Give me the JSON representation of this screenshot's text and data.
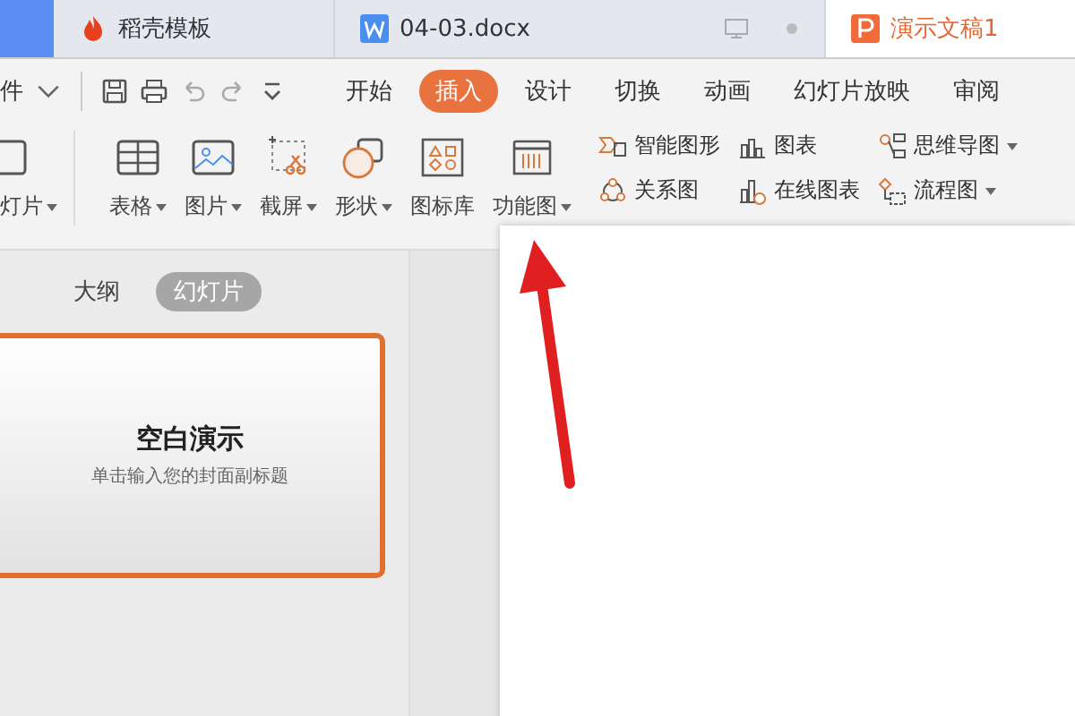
{
  "tabs": [
    {
      "label": "稻壳模板",
      "kind": "docer",
      "selected": false
    },
    {
      "label": "04-03.docx",
      "kind": "writer",
      "selected": false
    },
    {
      "label": "演示文稿1",
      "kind": "presentation",
      "selected": true
    }
  ],
  "menu": {
    "file_label": "件",
    "tabs": [
      {
        "label": "开始",
        "selected": false
      },
      {
        "label": "插入",
        "selected": true
      },
      {
        "label": "设计",
        "selected": false
      },
      {
        "label": "切换",
        "selected": false
      },
      {
        "label": "动画",
        "selected": false
      },
      {
        "label": "幻灯片放映",
        "selected": false
      },
      {
        "label": "审阅",
        "selected": false
      }
    ]
  },
  "ribbon": {
    "large": [
      {
        "label": "灯片",
        "kind": "slide",
        "dropdown": true
      },
      {
        "label": "表格",
        "kind": "table",
        "dropdown": true
      },
      {
        "label": "图片",
        "kind": "image",
        "dropdown": true
      },
      {
        "label": "截屏",
        "kind": "screenshot",
        "dropdown": true
      },
      {
        "label": "形状",
        "kind": "shape",
        "dropdown": true
      },
      {
        "label": "图标库",
        "kind": "iconlib",
        "dropdown": false
      },
      {
        "label": "功能图",
        "kind": "function",
        "dropdown": true
      }
    ],
    "small": [
      {
        "label": "智能图形",
        "kind": "smartart",
        "dropdown": false
      },
      {
        "label": "关系图",
        "kind": "relation",
        "dropdown": false
      },
      {
        "label": "图表",
        "kind": "chart",
        "dropdown": false
      },
      {
        "label": "在线图表",
        "kind": "onlinechart",
        "dropdown": false
      },
      {
        "label": "思维导图",
        "kind": "mindmap",
        "dropdown": true
      },
      {
        "label": "流程图",
        "kind": "flow",
        "dropdown": true
      }
    ]
  },
  "panel": {
    "tabs": [
      {
        "label": "大纲",
        "selected": false
      },
      {
        "label": "幻灯片",
        "selected": true
      }
    ]
  },
  "thumbnail": {
    "title": "空白演示",
    "subtitle": "单击输入您的封面副标题",
    "selected": true
  }
}
